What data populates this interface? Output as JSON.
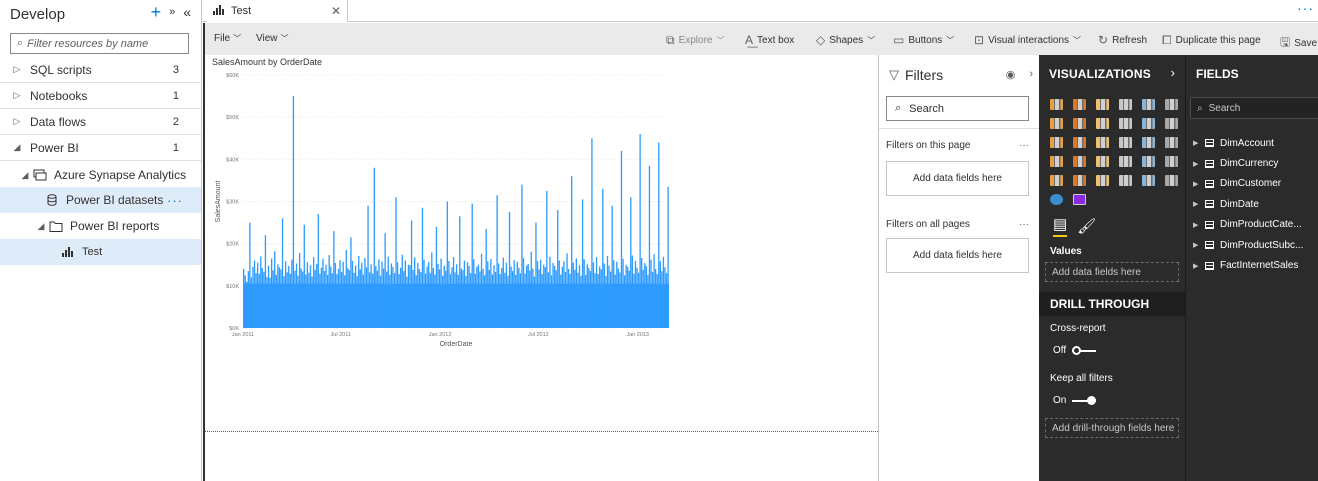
{
  "sidebar": {
    "title": "Develop",
    "filter_placeholder": "Filter resources by name",
    "items": [
      {
        "label": "SQL scripts",
        "count": "3"
      },
      {
        "label": "Notebooks",
        "count": "1"
      },
      {
        "label": "Data flows",
        "count": "2"
      },
      {
        "label": "Power BI",
        "count": "1"
      }
    ],
    "workspace": "Azure Synapse Analytics",
    "datasets": "Power BI datasets",
    "reports": "Power BI reports",
    "report_item": "Test"
  },
  "tab": {
    "label": "Test"
  },
  "toolbar": {
    "file": "File",
    "view": "View",
    "explore": "Explore",
    "textbox": "Text box",
    "shapes": "Shapes",
    "buttons": "Buttons",
    "visual_interactions": "Visual interactions",
    "refresh": "Refresh",
    "duplicate": "Duplicate this page",
    "save": "Save"
  },
  "filters": {
    "title": "Filters",
    "search": "Search",
    "on_page": "Filters on this page",
    "on_all": "Filters on all pages",
    "add": "Add data fields here"
  },
  "visualizations": {
    "title": "VISUALIZATIONS",
    "values_label": "Values",
    "add_fields": "Add data fields here",
    "drill_through": "DRILL THROUGH",
    "cross_report": "Cross-report",
    "cross_report_state": "Off",
    "keep_filters": "Keep all filters",
    "keep_filters_state": "On",
    "add_drill": "Add drill-through fields here"
  },
  "fields": {
    "title": "FIELDS",
    "search": "Search",
    "tables": [
      "DimAccount",
      "DimCurrency",
      "DimCustomer",
      "DimDate",
      "DimProductCate...",
      "DimProductSubc...",
      "FactInternetSales"
    ]
  },
  "colors": {
    "accent": "#0078d4",
    "bar": "#2e9bff",
    "dark_pane": "#2b2b2b",
    "toggle_on": "#ffffff"
  },
  "chart_data": {
    "type": "bar",
    "title": "SalesAmount by OrderDate",
    "xlabel": "OrderDate",
    "ylabel": "SalesAmount",
    "ylim": [
      0,
      60000
    ],
    "yticks": [
      "$0K",
      "$10K",
      "$20K",
      "$30K",
      "$40K",
      "$50K",
      "$60K"
    ],
    "xticks": [
      "Jan 2011",
      "Jul 2011",
      "Jan 2012",
      "Jul 2012",
      "Jan 2013"
    ],
    "x_range": [
      "2011-01-01",
      "2013-02-28"
    ],
    "grid": true,
    "series": [
      {
        "values": [
          14000,
          12500,
          11000,
          13500,
          25000,
          12000,
          14500,
          16000,
          13000,
          15500,
          12800,
          17000,
          14200,
          13300,
          22000,
          12100,
          14800,
          11900,
          16500,
          13700,
          18200,
          12600,
          15100,
          14400,
          13900,
          26000,
          12300,
          15800,
          13200,
          14700,
          12900,
          16200,
          55000,
          13600,
          15300,
          12400,
          17800,
          14100,
          13400,
          24500,
          12700,
          15600,
          13100,
          14900,
          12200,
          16800,
          13800,
          15200,
          27000,
          12900,
          14300,
          16400,
          13500,
          15000,
          12600,
          17300,
          14600,
          13000,
          23000,
          15400,
          12800,
          14000,
          16100,
          13300,
          15700,
          12500,
          18500,
          14200,
          13700,
          21500,
          15900,
          13100,
          14800,
          12300,
          17100,
          13900,
          15500,
          12700,
          16600,
          14400,
          29000,
          13200,
          15100,
          12900,
          38000,
          14700,
          13600,
          16300,
          12400,
          15800,
          14100,
          22500,
          13400,
          16900,
          12600,
          15300,
          14500,
          13000,
          31000,
          15600,
          12800,
          14300,
          17400,
          13500,
          16000,
          12200,
          15000,
          14900,
          25500,
          13800,
          16700,
          12500,
          15400,
          14000,
          13300,
          28500,
          16200,
          12900,
          14600,
          15700,
          13100,
          17900,
          14200,
          12700,
          24000,
          15200,
          13900,
          16500,
          12400,
          14800,
          13600,
          30000,
          15900,
          12800,
          14400,
          16800,
          13200,
          15100,
          12600,
          26500,
          14100,
          13700,
          16000,
          12300,
          15600,
          14700,
          13000,
          29500,
          16300,
          12900,
          14500,
          15000,
          13400,
          17600,
          14000,
          12500,
          23500,
          15800,
          13800,
          16400,
          12700,
          14900,
          13300,
          31500,
          15300,
          12800,
          14200,
          16700,
          13100,
          15500,
          12400,
          27500,
          14600,
          13500,
          16100,
          12600,
          15700,
          14300,
          13000,
          34000,
          16600,
          12900,
          14800,
          15200,
          13600,
          18100,
          14100,
          12200,
          25000,
          15900,
          13900,
          16200,
          12800,
          15000,
          14400,
          32500,
          13200,
          16900,
          12500,
          15400,
          14700,
          13700,
          28000,
          16000,
          12700,
          14500,
          15800,
          13300,
          17700,
          14000,
          12900,
          36000,
          15500,
          13800,
          16500,
          13100,
          14900,
          12400,
          30500,
          16300,
          12600,
          15100,
          14200,
          13500,
          45000,
          15600,
          13000,
          16800,
          12800,
          14600,
          13900,
          33000,
          15300,
          12300,
          17100,
          14800,
          13400,
          29000,
          16100,
          12700,
          15700,
          14100,
          13200,
          42000,
          16400,
          12500,
          15000,
          14500,
          13600,
          31000,
          17200,
          12900,
          15900,
          14300,
          13100,
          46000,
          16600,
          13800,
          15400,
          14700,
          12600,
          38500,
          16200,
          13300,
          17500,
          14000,
          12800,
          44000,
          15800,
          13500,
          16900,
          14400,
          13000,
          33500
        ]
      }
    ]
  }
}
